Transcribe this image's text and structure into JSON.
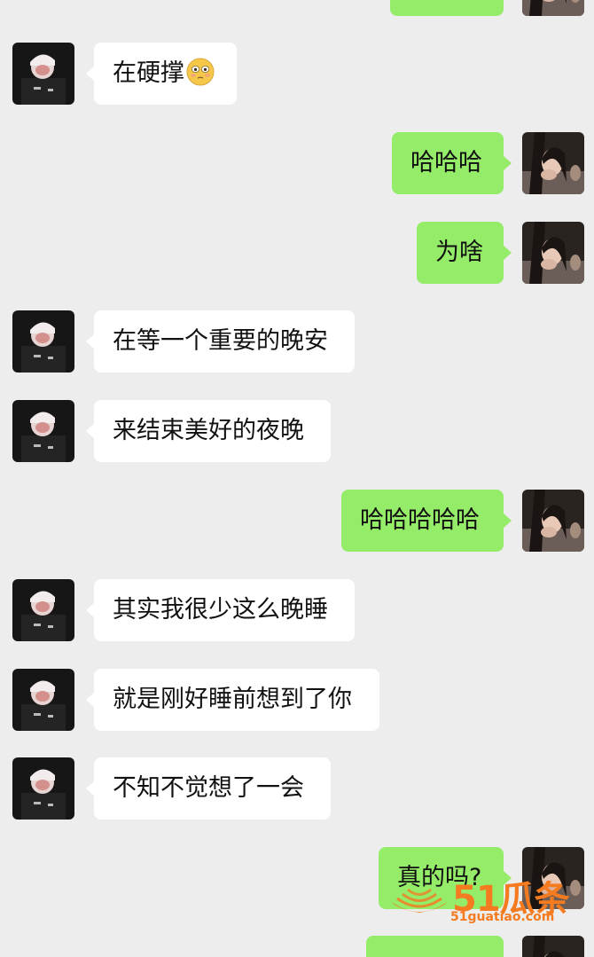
{
  "messages": [
    {
      "side": "right",
      "text": ""
    },
    {
      "side": "left",
      "text": "在硬撑",
      "emoji": "flushed-face-emoji"
    },
    {
      "side": "right",
      "text": "哈哈哈"
    },
    {
      "side": "right",
      "text": "为啥"
    },
    {
      "side": "left",
      "text": "在等一个重要的晚安"
    },
    {
      "side": "left",
      "text": "来结束美好的夜晚"
    },
    {
      "side": "right",
      "text": "哈哈哈哈哈"
    },
    {
      "side": "left",
      "text": "其实我很少这么晚睡"
    },
    {
      "side": "left",
      "text": "就是刚好睡前想到了你"
    },
    {
      "side": "left",
      "text": "不知不觉想了一会"
    },
    {
      "side": "right",
      "text": "真的吗?"
    },
    {
      "side": "right",
      "text": ""
    }
  ],
  "watermark": {
    "brand": "51瓜条",
    "url": "51guatiao.com"
  },
  "colors": {
    "background": "#ededed",
    "sent_bubble": "#95ec69",
    "received_bubble": "#ffffff",
    "watermark": "#f47b20"
  }
}
